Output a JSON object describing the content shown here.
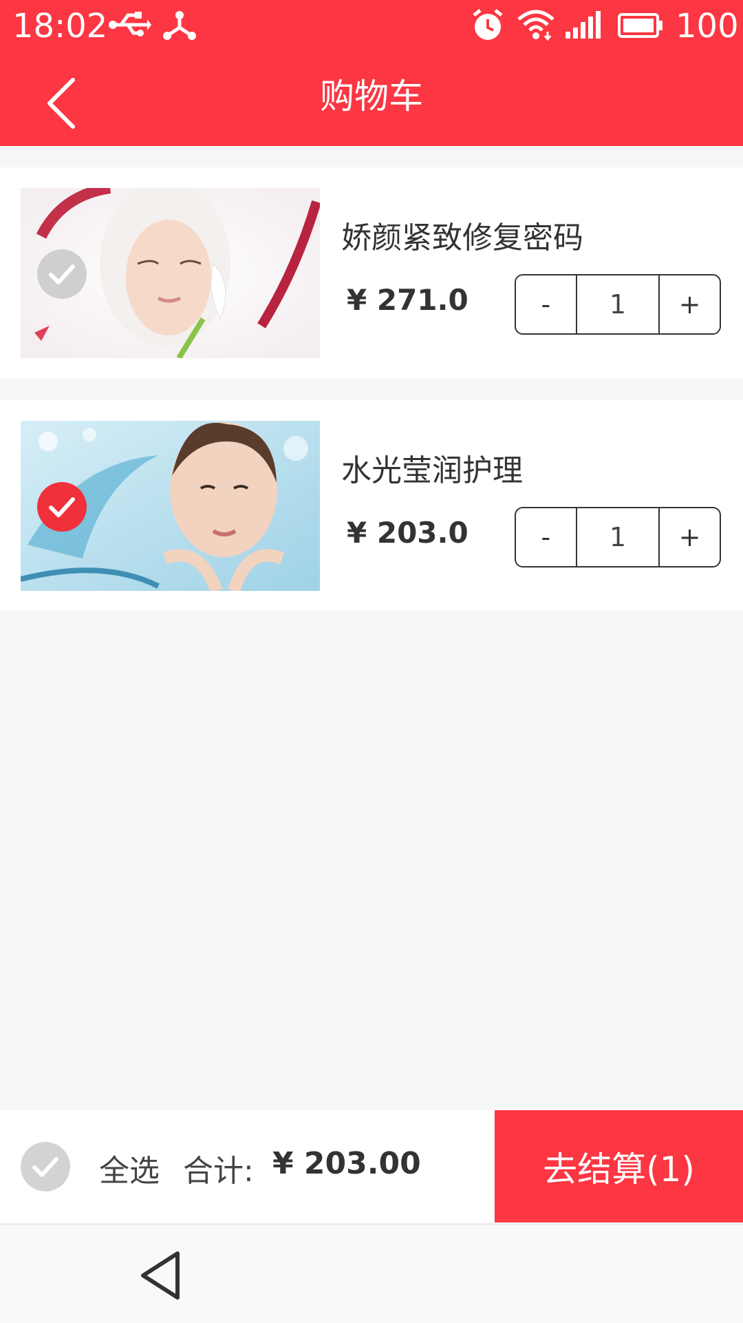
{
  "status_bar": {
    "time": "18:02",
    "battery": "100",
    "icons": [
      "usb-icon",
      "share-icon",
      "alarm-icon",
      "wifi-icon",
      "signal-icon",
      "battery-icon"
    ]
  },
  "header": {
    "title": "购物车",
    "back_icon": "chevron-left-icon",
    "background_color": "#fc3642"
  },
  "cart": {
    "items": [
      {
        "name": "娇颜紧致修复密码",
        "price": "¥ 271.0",
        "quantity": "1",
        "minus": "-",
        "plus": "+",
        "selected": false
      },
      {
        "name": "水光莹润护理",
        "price": "¥ 203.0",
        "quantity": "1",
        "minus": "-",
        "plus": "+",
        "selected": true
      }
    ]
  },
  "footer": {
    "select_all_label": "全选",
    "total_label": "合计:",
    "total_value": "¥ 203.00",
    "checkout_label": "去结算(1)"
  },
  "colors": {
    "accent": "#fc3642",
    "unchecked": "#cfcfcf",
    "background": "#f7f7f7"
  }
}
